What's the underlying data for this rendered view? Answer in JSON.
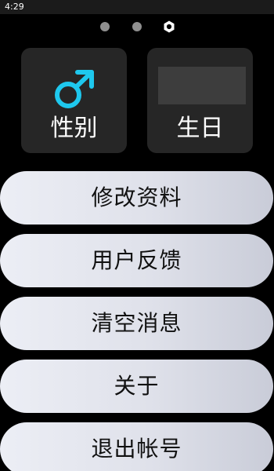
{
  "status_bar": {
    "time": "4:29"
  },
  "pager": {
    "icons": [
      "dot-icon",
      "dot-icon",
      "settings-icon"
    ],
    "active_index": 2
  },
  "tiles": {
    "gender": {
      "label": "性别",
      "icon": "male-symbol-icon",
      "icon_color": "#1ec8ee"
    },
    "birthday": {
      "label": "生日",
      "value": ""
    }
  },
  "menu": {
    "items": [
      {
        "label": "修改资料"
      },
      {
        "label": "用户反馈"
      },
      {
        "label": "清空消息"
      },
      {
        "label": "关于"
      },
      {
        "label": "退出帐号"
      }
    ]
  },
  "colors": {
    "background": "#000000",
    "tile": "#262626",
    "button_start": "#eceef5",
    "button_end": "#c9ccd8",
    "accent": "#1ec8ee"
  }
}
